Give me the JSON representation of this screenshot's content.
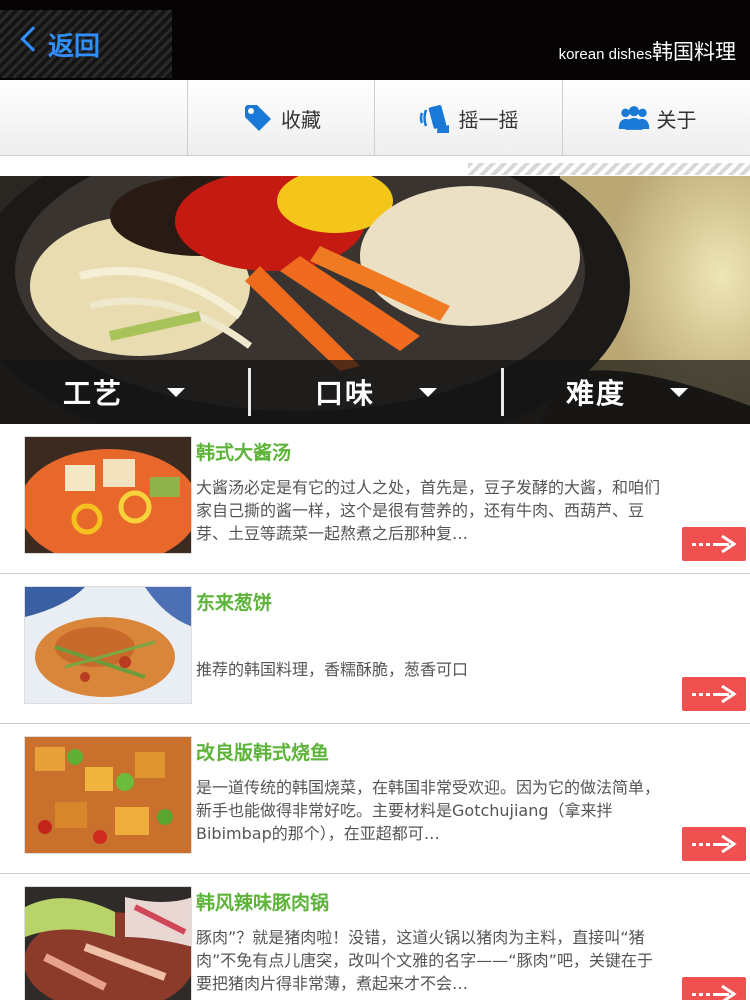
{
  "header": {
    "back_label": "返回",
    "title_en": "korean dishes",
    "title_zh": "韩国料理"
  },
  "toolbar": {
    "items": [
      {
        "label": "",
        "icon": "blank"
      },
      {
        "label": "收藏",
        "icon": "tag-icon"
      },
      {
        "label": "摇一摇",
        "icon": "shake-phone-icon"
      },
      {
        "label": "关于",
        "icon": "people-icon"
      }
    ]
  },
  "filters": [
    {
      "label": "工艺"
    },
    {
      "label": "口味"
    },
    {
      "label": "难度"
    }
  ],
  "dishes": [
    {
      "title": "韩式大酱汤",
      "desc": "大酱汤必定是有它的过人之处，首先是，豆子发酵的大酱，和咱们家自己撕的酱一样，这个是很有营养的，还有牛肉、西葫芦、豆芽、土豆等蔬菜一起熬煮之后那种复…"
    },
    {
      "title": "东来葱饼",
      "desc": "推荐的韩国料理，香糯酥脆，葱香可口"
    },
    {
      "title": "改良版韩式烧鱼",
      "desc": "是一道传统的韩国烧菜，在韩国非常受欢迎。因为它的做法简单，新手也能做得非常好吃。主要材料是Gotchujiang（拿来拌Bibimbap的那个），在亚超都可…"
    },
    {
      "title": "韩风辣味豚肉锅",
      "desc": "豚肉”？就是猪肉啦！没错，这道火锅以猪肉为主料，直接叫“猪肉”不免有点儿唐突，改叫个文雅的名字——“豚肉”吧，关键在于要把猪肉片得非常薄，煮起来才不会…"
    }
  ],
  "colors": {
    "accent_blue": "#2f8fff",
    "title_green": "#5eb43a",
    "arrow_red": "#f05050"
  }
}
